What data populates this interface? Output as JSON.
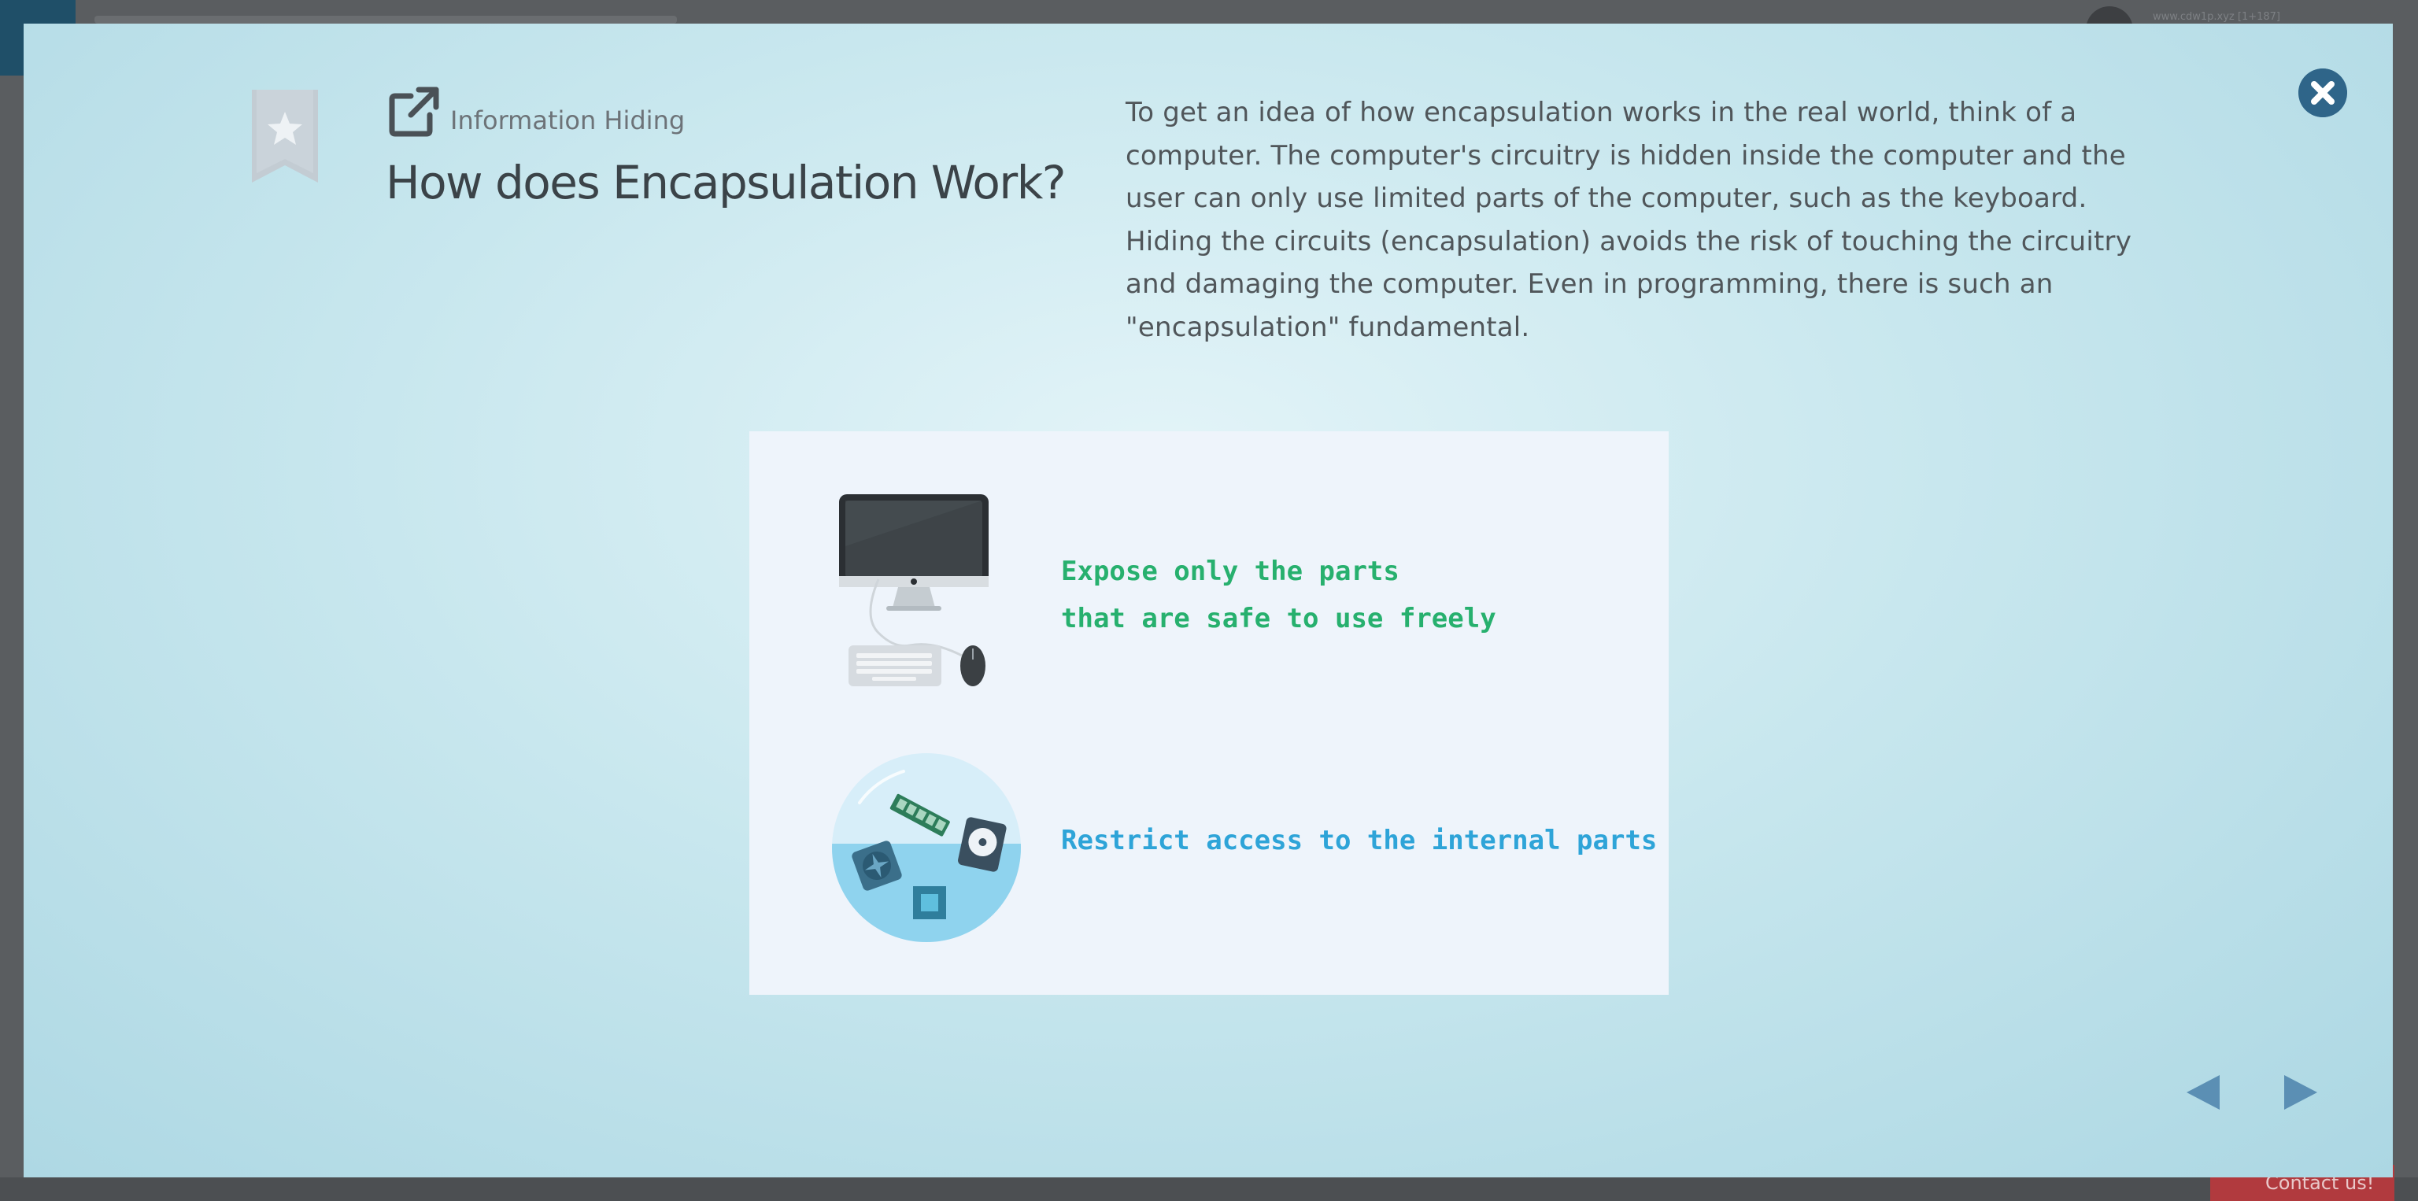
{
  "background": {
    "url_text": "www.cdw1p.xyz [1+187]",
    "contact_label": "Contact us!"
  },
  "header": {
    "subtitle": "Information Hiding",
    "title": "How does Encapsulation Work?"
  },
  "description": "To get an idea of how encapsulation works in the real world, think of a computer. The computer's circuitry is hidden inside the computer and the user can only use limited parts of the computer, such as the keyboard. Hiding the circuits (encapsulation) avoids the risk of touching the circuitry and damaging the computer. Even in programming, there is such an \"encapsulation\" fundamental.",
  "figure": {
    "expose_line1": "Expose only the parts",
    "expose_line2": "that are safe to use freely",
    "restrict_text": "Restrict access to the internal parts"
  },
  "colors": {
    "modal_accent": "#2f6589",
    "expose_green": "#27b06e",
    "restrict_blue": "#2ea4d8",
    "nav_arrow": "#5b8fb4"
  },
  "icons": {
    "bookmark": "bookmark-star-icon",
    "external": "external-link-icon",
    "close": "close-icon",
    "prev": "arrow-left-icon",
    "next": "arrow-right-icon"
  }
}
